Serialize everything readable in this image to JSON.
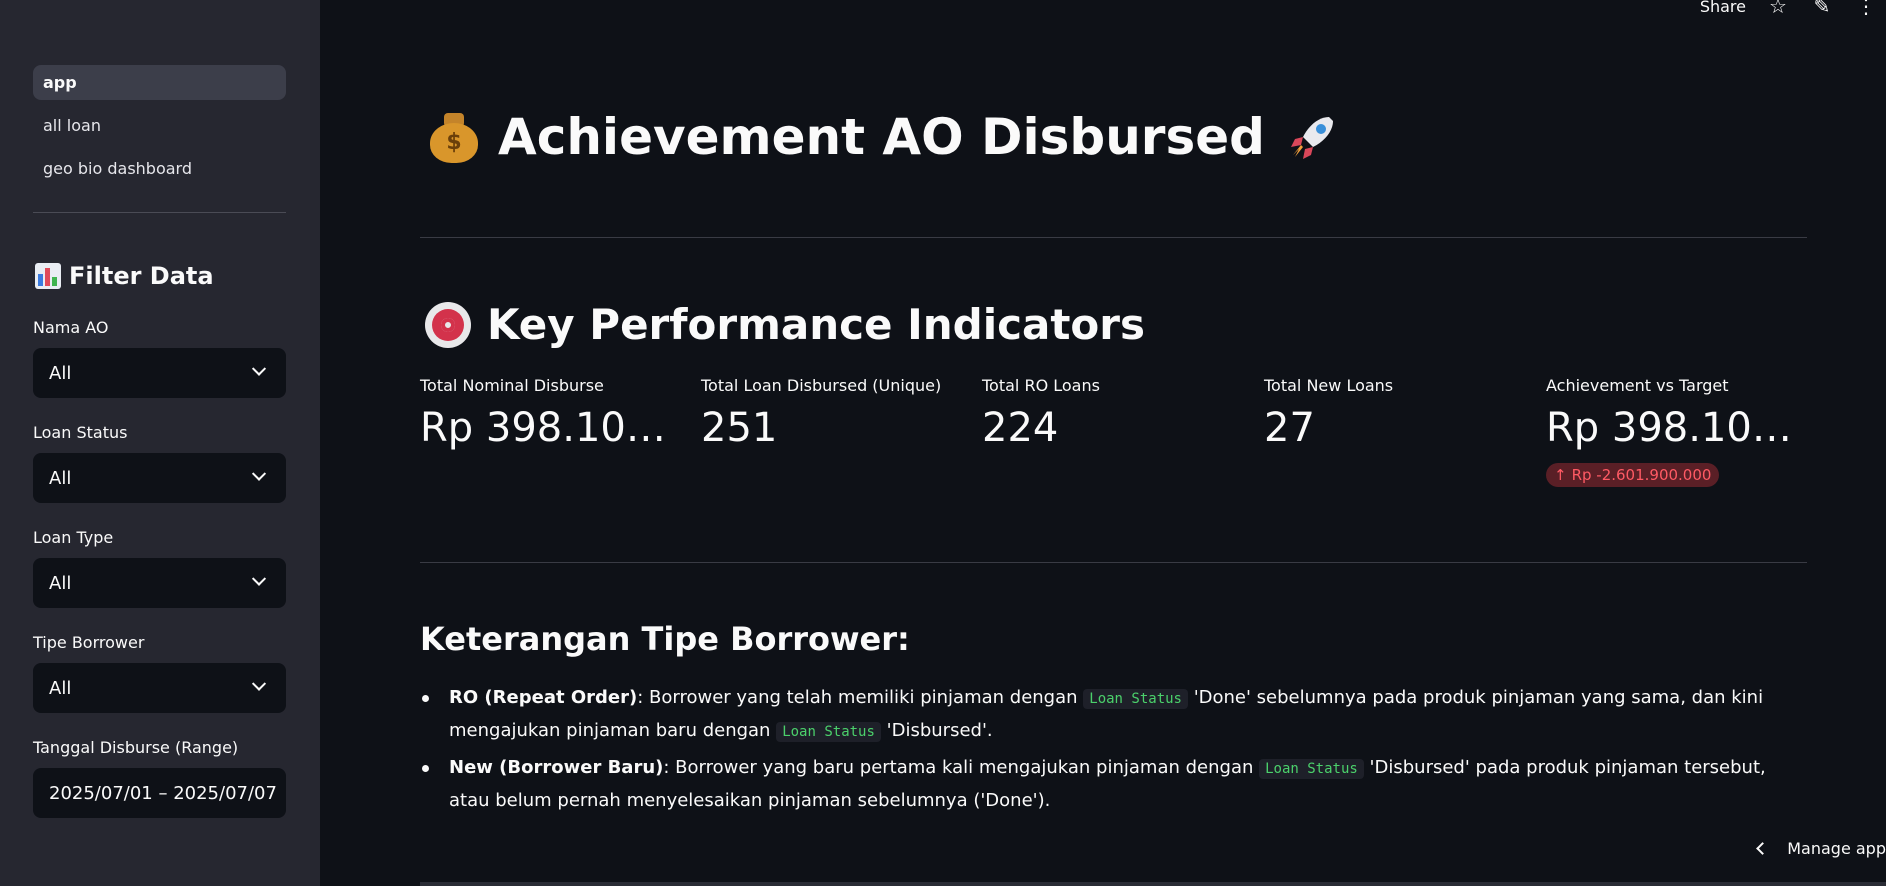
{
  "sidebar": {
    "nav": [
      {
        "label": "app",
        "active": true
      },
      {
        "label": "all loan",
        "active": false
      },
      {
        "label": "geo bio dashboard",
        "active": false
      }
    ],
    "filter_title": "Filter Data",
    "filter_icon": "bar-chart-icon",
    "filters": [
      {
        "label": "Nama AO",
        "value": "All"
      },
      {
        "label": "Loan Status",
        "value": "All"
      },
      {
        "label": "Loan Type",
        "value": "All"
      },
      {
        "label": "Tipe Borrower",
        "value": "All"
      },
      {
        "label": "Tanggal Disburse (Range)",
        "value": "2025/07/01 – 2025/07/07"
      }
    ]
  },
  "topbar": {
    "share_label": "Share"
  },
  "header": {
    "title": "Achievement AO Disbursed",
    "title_icon_left": "money-bag-icon",
    "title_icon_right": "rocket-icon"
  },
  "kpi": {
    "title": "Key Performance Indicators",
    "title_icon": "target-icon",
    "metrics": [
      {
        "label": "Total Nominal Disburse",
        "value": "Rp 398.100...."
      },
      {
        "label": "Total Loan Disbursed (Unique)",
        "value": "251"
      },
      {
        "label": "Total RO Loans",
        "value": "224"
      },
      {
        "label": "Total New Loans",
        "value": "27"
      },
      {
        "label": "Achievement vs Target",
        "value": "Rp 398.100....",
        "delta": "Rp -2.601.900.000"
      }
    ]
  },
  "legend": {
    "title": "Keterangan Tipe Borrower:",
    "items": [
      {
        "term": "RO (Repeat Order)",
        "p1": ": Borrower yang telah memiliki pinjaman dengan ",
        "code1": "Loan Status",
        "p2": " 'Done' sebelumnya pada produk pinjaman yang sama, dan kini mengajukan pinjaman baru dengan ",
        "code2": "Loan Status",
        "p3": " 'Disbursed'."
      },
      {
        "term": "New (Borrower Baru)",
        "p1": ": Borrower yang baru pertama kali mengajukan pinjaman dengan ",
        "code1": "Loan Status",
        "p2": " 'Disbursed' pada produk pinjaman tersebut, atau belum pernah menyelesaikan pinjaman sebelumnya ('Done')."
      }
    ]
  },
  "footer": {
    "manage_label": "Manage app"
  }
}
